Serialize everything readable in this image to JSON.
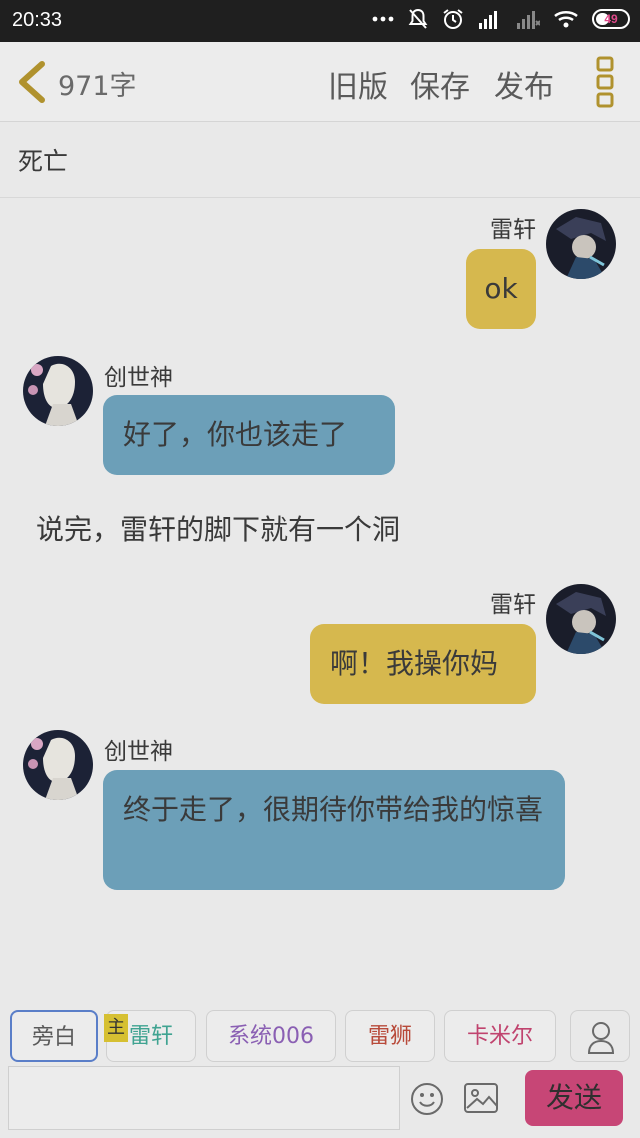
{
  "status_bar": {
    "time": "20:33",
    "battery": "49"
  },
  "toolbar": {
    "word_count": "971字",
    "old_version": "旧版",
    "save": "保存",
    "publish": "发布"
  },
  "title": "死亡",
  "messages": [
    {
      "sender": "雷轩",
      "text": "ok",
      "side": "right",
      "color": "#d6b84e"
    },
    {
      "sender": "创世神",
      "text": "好了，你也该走了",
      "side": "left",
      "color": "#6c9fb8"
    },
    {
      "narration": "说完，雷轩的脚下就有一个洞"
    },
    {
      "sender": "雷轩",
      "text": "啊！我操你妈",
      "side": "right",
      "color": "#d6b84e"
    },
    {
      "sender": "创世神",
      "text": "终于走了，很期待你带给我的惊喜",
      "side": "left",
      "color": "#6c9fb8"
    }
  ],
  "roles": [
    {
      "label": "旁白",
      "color": "#5a5a5a"
    },
    {
      "label": "雷轩",
      "color": "#3fa391",
      "badge": "主"
    },
    {
      "label": "系统006",
      "color": "#8a5fb3"
    },
    {
      "label": "雷狮",
      "color": "#b84a3a"
    },
    {
      "label": "卡米尔",
      "color": "#c0436e"
    }
  ],
  "input": {
    "placeholder": ""
  },
  "send": "发送"
}
